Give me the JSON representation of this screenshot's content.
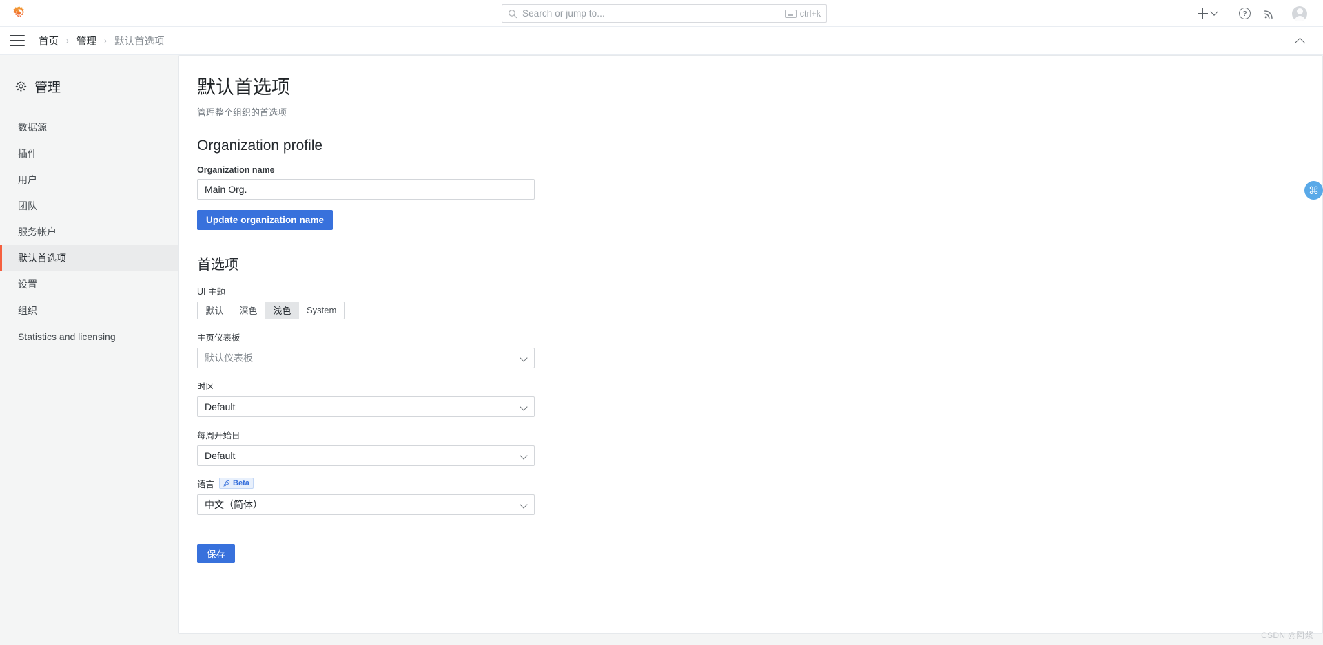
{
  "topbar": {
    "logo_icon": "grafana-logo-icon",
    "search": {
      "placeholder": "Search or jump to...",
      "icon": "search-icon",
      "shortcut": "ctrl+k",
      "shortcut_icon": "keyboard-icon"
    },
    "actions": {
      "add_icon": "plus-icon",
      "add_chevron_icon": "chevron-down-icon",
      "help_icon": "help-circle-icon",
      "help_glyph": "?",
      "news_icon": "rss-icon",
      "avatar_icon": "user-avatar-icon"
    }
  },
  "breadcrumb_bar": {
    "menu_icon": "hamburger-menu-icon",
    "items": [
      {
        "label": "首页",
        "current": false
      },
      {
        "label": "管理",
        "current": false
      },
      {
        "label": "默认首选项",
        "current": true
      }
    ],
    "separator": "›",
    "collapse_icon": "chevron-up-icon"
  },
  "sidebar": {
    "title": "管理",
    "title_icon": "gear-icon",
    "items": [
      {
        "label": "数据源",
        "active": false
      },
      {
        "label": "插件",
        "active": false
      },
      {
        "label": "用户",
        "active": false
      },
      {
        "label": "团队",
        "active": false
      },
      {
        "label": "服务帐户",
        "active": false
      },
      {
        "label": "默认首选项",
        "active": true
      },
      {
        "label": "设置",
        "active": false
      },
      {
        "label": "组织",
        "active": false
      },
      {
        "label": "Statistics and licensing",
        "active": false
      }
    ],
    "active_accent_color": "#f55f3e"
  },
  "main": {
    "page_title": "默认首选项",
    "page_subtitle": "管理整个组织的首选项",
    "org_profile": {
      "heading": "Organization profile",
      "name_label": "Organization name",
      "name_value": "Main Org.",
      "update_button": "Update organization name"
    },
    "preferences": {
      "heading": "首选项",
      "ui_theme": {
        "label": "UI 主题",
        "options": [
          {
            "label": "默认",
            "selected": false
          },
          {
            "label": "深色",
            "selected": false
          },
          {
            "label": "浅色",
            "selected": true
          },
          {
            "label": "System",
            "selected": false
          }
        ]
      },
      "home_dashboard": {
        "label": "主页仪表板",
        "value": "默认仪表板",
        "is_placeholder": true,
        "chevron_icon": "chevron-down-icon"
      },
      "timezone": {
        "label": "时区",
        "value": "Default",
        "is_placeholder": false,
        "chevron_icon": "chevron-down-icon"
      },
      "week_start": {
        "label": "每周开始日",
        "value": "Default",
        "is_placeholder": false,
        "chevron_icon": "chevron-down-icon"
      },
      "language": {
        "label": "语言",
        "badge": "Beta",
        "badge_icon": "rocket-icon",
        "value": "中文（简体）",
        "is_placeholder": false,
        "chevron_icon": "chevron-down-icon"
      },
      "save_button": "保存"
    }
  },
  "floating_button": {
    "icon": "command-icon",
    "glyph": "⌘"
  },
  "watermark": "CSDN @阿浆",
  "colors": {
    "primary_button": "#3871dc",
    "accent": "#f55f3e",
    "panel_bg": "#ffffff",
    "app_bg": "#f4f5f5"
  }
}
